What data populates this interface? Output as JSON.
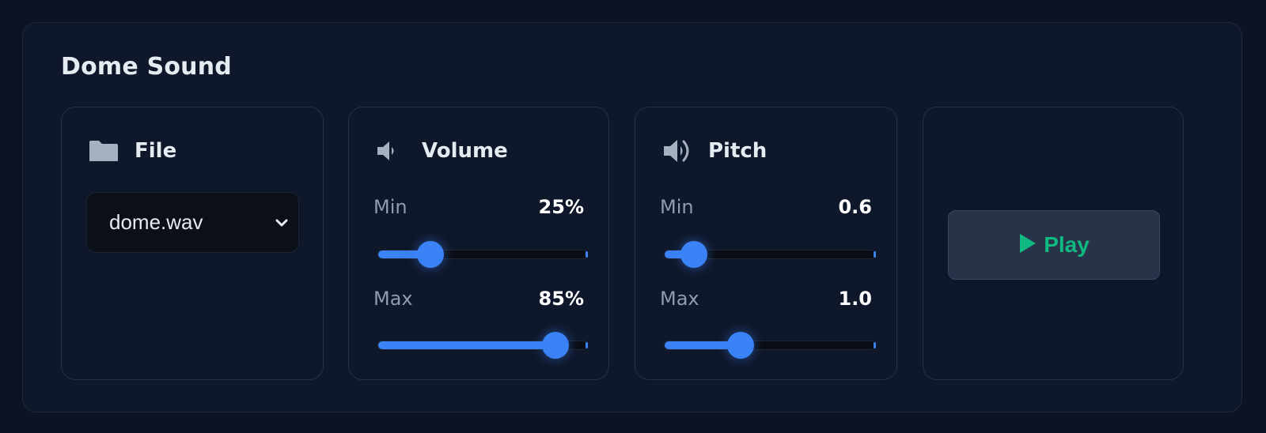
{
  "panel": {
    "title": "Dome Sound"
  },
  "file": {
    "label": "File",
    "icon": "folder-icon",
    "selected": "dome.wav"
  },
  "volume": {
    "label": "Volume",
    "icon": "speaker-low-icon",
    "min_label": "Min",
    "min_value": "25%",
    "min_fraction": 0.25,
    "max_label": "Max",
    "max_value": "85%",
    "max_fraction": 0.85
  },
  "pitch": {
    "label": "Pitch",
    "icon": "speaker-high-icon",
    "min_label": "Min",
    "min_value": "0.6",
    "min_fraction": 0.14,
    "max_label": "Max",
    "max_value": "1.0",
    "max_fraction": 0.36
  },
  "play": {
    "label": "Play",
    "icon": "play-icon"
  },
  "colors": {
    "accent": "#3b82f6",
    "play": "#10b981",
    "background": "#0f172a"
  }
}
